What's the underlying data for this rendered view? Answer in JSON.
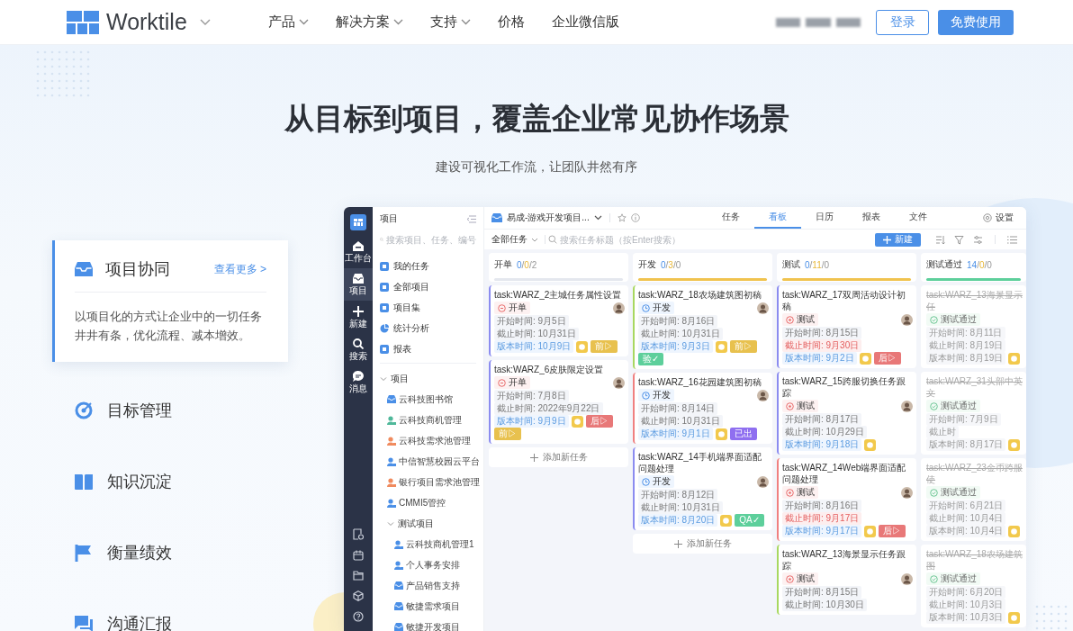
{
  "header": {
    "brand": "Worktile",
    "nav": [
      {
        "label": "产品",
        "has_menu": true
      },
      {
        "label": "解决方案",
        "has_menu": true
      },
      {
        "label": "支持",
        "has_menu": true
      },
      {
        "label": "价格",
        "has_menu": false
      },
      {
        "label": "企业微信版",
        "has_menu": false
      }
    ],
    "login": "登录",
    "signup": "免费使用"
  },
  "hero": {
    "title": "从目标到项目，覆盖企业常见协作场景",
    "subtitle": "建设可视化工作流，让团队井然有序"
  },
  "features": [
    {
      "label": "项目协同",
      "selected": true,
      "more": "查看更多 >",
      "description": "以项目化的方式让企业中的一切任务井井有条，优化流程、减本增效。"
    },
    {
      "label": "目标管理",
      "selected": false
    },
    {
      "label": "知识沉淀",
      "selected": false
    },
    {
      "label": "衡量绩效",
      "selected": false
    },
    {
      "label": "沟通汇报",
      "selected": false
    }
  ],
  "app": {
    "rail": [
      {
        "label": "工作台",
        "kind": "home",
        "selected": false
      },
      {
        "label": "项目",
        "kind": "tray",
        "selected": true
      },
      {
        "label": "新建",
        "kind": "plus",
        "selected": false
      },
      {
        "label": "搜索",
        "kind": "search",
        "selected": false
      },
      {
        "label": "消息",
        "kind": "chat",
        "selected": false
      }
    ],
    "sidebar": {
      "title": "项目",
      "search": {
        "placeholder": "搜索项目、任务、编号"
      },
      "nav": [
        "我的任务",
        "全部项目",
        "项目集",
        "统计分析",
        "报表"
      ],
      "tree": [
        {
          "label": "项目",
          "expanded": true,
          "children": [
            {
              "label": "云科技图书馆",
              "kind": "box"
            },
            {
              "label": "云科技商机管理",
              "kind": "person",
              "color": "#4fb89a"
            },
            {
              "label": "云科技需求池管理",
              "kind": "person",
              "color": "#f08a5d"
            },
            {
              "label": "中信智慧校园云平台",
              "kind": "person",
              "color": "#4a8fe7"
            },
            {
              "label": "银行项目需求池管理",
              "kind": "person",
              "color": "#f08a5d"
            },
            {
              "label": "CMMI5管控",
              "kind": "person",
              "color": "#4a8fe7"
            },
            {
              "label": "测试项目",
              "expanded": true,
              "children": [
                {
                  "label": "云科技商机管理1",
                  "kind": "person",
                  "color": "#4a8fe7"
                },
                {
                  "label": "个人事务安排",
                  "kind": "person",
                  "color": "#4a8fe7"
                },
                {
                  "label": "产品销售支持",
                  "kind": "box"
                },
                {
                  "label": "敏捷需求项目",
                  "kind": "box"
                },
                {
                  "label": "敏捷开发项目",
                  "kind": "box"
                }
              ]
            }
          ]
        }
      ]
    },
    "project": "易成-游戏开发项目...",
    "tabs": [
      {
        "label": "任务",
        "selected": false
      },
      {
        "label": "看板",
        "selected": true
      },
      {
        "label": "日历",
        "selected": false
      },
      {
        "label": "报表",
        "selected": false
      },
      {
        "label": "文件",
        "selected": false
      }
    ],
    "settings": "设置",
    "filter": "全部任务",
    "task_search": {
      "placeholder": "搜索任务标题（按Enter搜索）"
    },
    "new_button": "新建",
    "board": {
      "columns": [
        {
          "name": "开单",
          "counts": [
            "0",
            "/",
            "0",
            "/",
            "2"
          ],
          "color": "#e4e7ee",
          "add_label": "添加新任务",
          "cards": [
            {
              "title": "task:WARZ_2主城任务属性设置",
              "status": {
                "kind": "open",
                "label": "开单"
              },
              "color": "#8b8cf0",
              "avatar": true,
              "fields": [
                {
                  "text": "开始时间: 9月5日",
                  "kind": "plain"
                },
                {
                  "text": "截止时间: 10月31日",
                  "kind": "plain"
                },
                {
                  "text": "版本时间: 10月9日",
                  "kind": "version"
                }
              ],
              "badge": true,
              "tags": [
                {
                  "text": "前▷",
                  "color": "#e8c14e"
                }
              ]
            },
            {
              "title": "task:WARZ_6皮肤限定设置",
              "status": {
                "kind": "open",
                "label": "开单"
              },
              "color": "#8b8cf0",
              "avatar": true,
              "fields": [
                {
                  "text": "开始时间: 7月8日",
                  "kind": "plain"
                },
                {
                  "text": "截止时间: 2022年9月22日",
                  "kind": "plain"
                },
                {
                  "text": "版本时间: 9月9日",
                  "kind": "version"
                }
              ],
              "badge": true,
              "tags": [
                {
                  "text": "后▷",
                  "color": "#e87878"
                },
                {
                  "text": "前▷",
                  "color": "#e8c14e"
                }
              ]
            }
          ]
        },
        {
          "name": "开发",
          "counts": [
            "0",
            "/",
            "3",
            "/",
            "0"
          ],
          "color": "#f0c34e",
          "add_label": "添加新任务",
          "cards": [
            {
              "title": "task:WARZ_18农场建筑图初稿",
              "status": {
                "kind": "dev",
                "label": "开发"
              },
              "color": "#a8d860",
              "avatar": true,
              "fields": [
                {
                  "text": "开始时间: 8月16日",
                  "kind": "plain"
                },
                {
                  "text": "截止时间: 10月31日",
                  "kind": "plain"
                },
                {
                  "text": "版本时间: 9月3日",
                  "kind": "version"
                }
              ],
              "badge": true,
              "tags": [
                {
                  "text": "前▷",
                  "color": "#e8c14e"
                },
                {
                  "text": "验✓",
                  "color": "#5dcf9b"
                }
              ]
            },
            {
              "title": "task:WARZ_16花园建筑图初稿",
              "status": {
                "kind": "dev",
                "label": "开发"
              },
              "color": "#f08080",
              "avatar": true,
              "fields": [
                {
                  "text": "开始时间: 8月14日",
                  "kind": "plain"
                },
                {
                  "text": "截止时间: 10月31日",
                  "kind": "plain"
                },
                {
                  "text": "版本时间: 9月1日",
                  "kind": "version"
                }
              ],
              "badge": true,
              "tags": [
                {
                  "text": "已出",
                  "color": "#8f6ff0"
                }
              ]
            },
            {
              "title": "task:WARZ_14手机端界面适配问题处理",
              "status": {
                "kind": "dev",
                "label": "开发"
              },
              "color": "#8b8cf0",
              "avatar": true,
              "fields": [
                {
                  "text": "开始时间: 8月12日",
                  "kind": "plain"
                },
                {
                  "text": "截止时间: 10月31日",
                  "kind": "plain"
                },
                {
                  "text": "版本时间: 8月20日",
                  "kind": "version"
                }
              ],
              "badge": true,
              "tags": [
                {
                  "text": "QA✓",
                  "color": "#5dcf9b"
                }
              ]
            }
          ]
        },
        {
          "name": "测试",
          "counts": [
            "0",
            "/",
            "11",
            "/",
            "0"
          ],
          "color": "#f0c34e",
          "cards": [
            {
              "title": "task:WARZ_17双周活动设计初稿",
              "status": {
                "kind": "test",
                "label": "测试"
              },
              "color": "#8b8cf0",
              "avatar": true,
              "fields": [
                {
                  "text": "开始时间: 8月15日",
                  "kind": "plain"
                },
                {
                  "text": "截止时间: 9月30日",
                  "kind": "danger"
                },
                {
                  "text": "版本时间: 9月2日",
                  "kind": "version"
                }
              ],
              "badge": true,
              "tags": [
                {
                  "text": "后▷",
                  "color": "#e87878"
                }
              ]
            },
            {
              "title": "task:WARZ_15跨服切换任务跟踪",
              "status": {
                "kind": "test",
                "label": "测试"
              },
              "color": "#8b8cf0",
              "avatar": true,
              "fields": [
                {
                  "text": "开始时间: 8月17日",
                  "kind": "plain"
                },
                {
                  "text": "截止时间: 10月29日",
                  "kind": "plain"
                },
                {
                  "text": "版本时间: 9月18日",
                  "kind": "version"
                }
              ],
              "badge": true
            },
            {
              "title": "task:WARZ_14Web端界面适配问题处理",
              "status": {
                "kind": "test",
                "label": "测试"
              },
              "color": "#f08080",
              "avatar": true,
              "fields": [
                {
                  "text": "开始时间: 8月16日",
                  "kind": "plain"
                },
                {
                  "text": "截止时间: 9月17日",
                  "kind": "danger"
                },
                {
                  "text": "版本时间: 9月17日",
                  "kind": "version"
                }
              ],
              "badge": true,
              "tags": [
                {
                  "text": "后▷",
                  "color": "#e87878"
                }
              ]
            },
            {
              "title": "task:WARZ_13海景显示任务跟踪",
              "status": {
                "kind": "test",
                "label": "测试"
              },
              "color": "#a8d860",
              "avatar": true,
              "fields": [
                {
                  "text": "开始时间: 8月15日",
                  "kind": "plain"
                },
                {
                  "text": "截止时间: 10月30日",
                  "kind": "plain"
                }
              ]
            }
          ]
        },
        {
          "name": "测试通过",
          "counts": [
            "14",
            "/",
            "0",
            "/",
            "0"
          ],
          "color": "#5dcf9b",
          "cards": [
            {
              "title": "task:WARZ_13海景显示任",
              "status": {
                "kind": "passed",
                "label": "测试通过"
              },
              "done": true,
              "fields": [
                {
                  "text": "开始时间: 8月11日",
                  "kind": "plain"
                },
                {
                  "text": "截止时间: 8月19日",
                  "kind": "plain"
                },
                {
                  "text": "版本时间: 8月19日",
                  "kind": "plain"
                }
              ],
              "badge": true
            },
            {
              "title": "task:WARZ_31头部中英文",
              "status": {
                "kind": "passed",
                "label": "测试通过"
              },
              "done": true,
              "fields": [
                {
                  "text": "开始时间: 7月9日",
                  "kind": "plain"
                },
                {
                  "text": "截止时",
                  "kind": "plain"
                },
                {
                  "text": "版本时间: 8月17日",
                  "kind": "plain"
                }
              ],
              "badge": true
            },
            {
              "title": "task:WARZ_23金币跨服使",
              "status": {
                "kind": "passed",
                "label": "测试通过"
              },
              "done": true,
              "fields": [
                {
                  "text": "开始时间: 6月21日",
                  "kind": "plain"
                },
                {
                  "text": "截止时间: 10月4日",
                  "kind": "plain"
                },
                {
                  "text": "版本时间: 10月4日",
                  "kind": "plain"
                }
              ],
              "badge": true
            },
            {
              "title": "task:WARZ_18农场建筑图",
              "status": {
                "kind": "passed",
                "label": "测试通过"
              },
              "done": true,
              "fields": [
                {
                  "text": "开始时间: 6月20日",
                  "kind": "plain"
                },
                {
                  "text": "截止时间: 10月3日",
                  "kind": "plain"
                },
                {
                  "text": "版本时间: 10月3日",
                  "kind": "plain"
                }
              ],
              "badge": true
            }
          ]
        }
      ]
    }
  }
}
